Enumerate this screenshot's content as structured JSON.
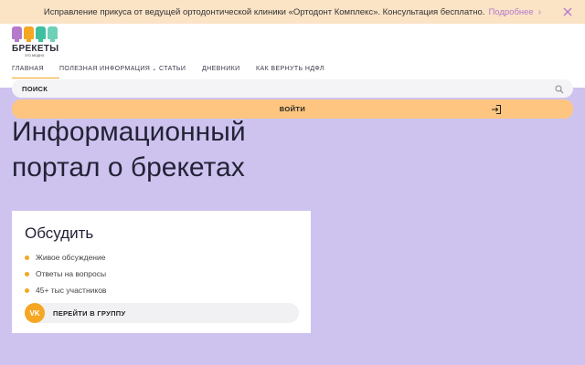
{
  "promo": {
    "text": "Исправление прикуса от ведущей ортодонтической клиники «Ортодонт Комплекс». Консультация бесплатно.",
    "more_link": "Подробнее"
  },
  "logo": {
    "title": "БРЕКЕТЫ",
    "subtitle": "это модно",
    "colors": [
      "#b47acc",
      "#f5a623",
      "#3fbf9f",
      "#6fd0b8"
    ]
  },
  "nav": {
    "items": [
      {
        "label": "ГЛАВНАЯ",
        "active": true
      },
      {
        "label": "ПОЛЕЗНАЯ ИНФОРМАЦИЯ",
        "dropdown": true
      },
      {
        "label": "СТАТЬИ"
      },
      {
        "label": "ДНЕВНИКИ"
      },
      {
        "label": "КАК ВЕРНУТЬ НДФЛ"
      }
    ]
  },
  "search": {
    "label": "ПОИСК"
  },
  "login": {
    "label": "ВОЙТИ"
  },
  "hero": {
    "headline_line1": "Информационный",
    "headline_line2": "портал о брекетах"
  },
  "card": {
    "title": "Обсудить",
    "items": [
      "Живое обсуждение",
      "Ответы на вопросы",
      "45+ тыс участников"
    ],
    "button_icon": "VK",
    "button_label": "ПЕРЕЙТИ В ГРУППУ"
  },
  "colors": {
    "accent": "#f5a623",
    "hero_bg": "#cec3ef",
    "promo_bg": "#fbe3c6",
    "login_bg": "#fdc57f"
  }
}
